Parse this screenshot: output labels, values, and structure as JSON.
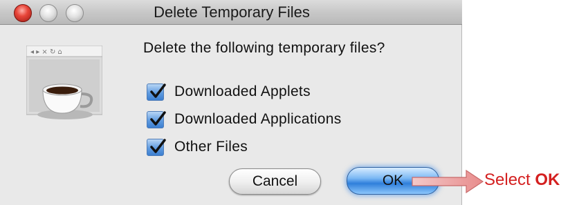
{
  "window": {
    "title": "Delete Temporary Files"
  },
  "dialog": {
    "question": "Delete the following temporary files?",
    "options": [
      {
        "label": "Downloaded Applets",
        "checked": true
      },
      {
        "label": "Downloaded Applications",
        "checked": true
      },
      {
        "label": "Other Files",
        "checked": true
      }
    ],
    "buttons": {
      "cancel_label": "Cancel",
      "ok_label": "OK"
    }
  },
  "annotation": {
    "prefix": "Select",
    "emphasis": "OK",
    "color": "#d42020"
  },
  "colors": {
    "accent": "#3c7fd0",
    "window_bg": "#e9e9e9"
  }
}
